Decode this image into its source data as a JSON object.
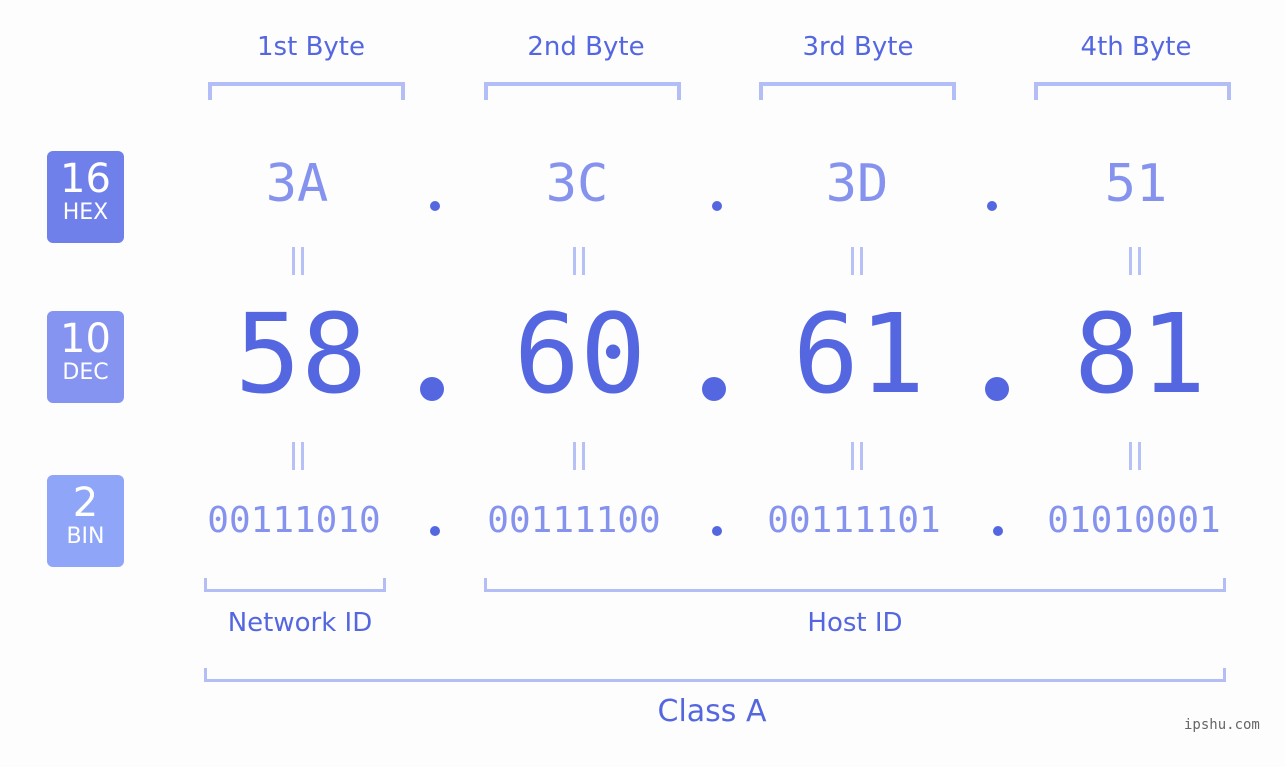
{
  "colors": {
    "primary": "#5567e0",
    "secondary": "#8593ee",
    "bracket": "#b3bdf6",
    "hex_badge": "#7080ea",
    "dec_badge": "#8594f0",
    "bin_badge": "#8fa6f8"
  },
  "bytes": [
    {
      "label": "1st Byte",
      "hex": "3A",
      "dec": "58",
      "bin": "00111010"
    },
    {
      "label": "2nd Byte",
      "hex": "3C",
      "dec": "60",
      "bin": "00111100"
    },
    {
      "label": "3rd Byte",
      "hex": "3D",
      "dec": "61",
      "bin": "00111101"
    },
    {
      "label": "4th Byte",
      "hex": "51",
      "dec": "81",
      "bin": "01010001"
    }
  ],
  "badges": {
    "hex": {
      "base": "16",
      "name": "HEX"
    },
    "dec": {
      "base": "10",
      "name": "DEC"
    },
    "bin": {
      "base": "2",
      "name": "BIN"
    }
  },
  "network_id_label": "Network ID",
  "host_id_label": "Host ID",
  "class_label": "Class A",
  "watermark": "ipshu.com"
}
